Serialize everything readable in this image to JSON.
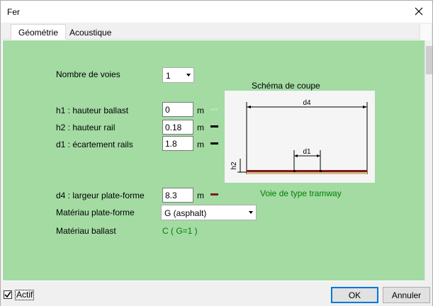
{
  "window": {
    "title": "Fer"
  },
  "tabs": [
    {
      "label": "Géométrie",
      "active": true
    },
    {
      "label": "Acoustique",
      "active": false
    }
  ],
  "form": {
    "nombre_voies": {
      "label": "Nombre de voies",
      "value": "1"
    },
    "h1": {
      "label": "h1 : hauteur ballast",
      "value": "0",
      "unit": "m",
      "swatch_color": "#b5e3b5"
    },
    "h2": {
      "label": "h2 : hauteur rail",
      "value": "0.18",
      "unit": "m",
      "swatch_color": "#000000"
    },
    "d1": {
      "label": "d1 : écartement rails",
      "value": "1.8",
      "unit": "m",
      "swatch_color": "#000000"
    },
    "d4": {
      "label": "d4 : largeur plate-forme",
      "value": "8.3",
      "unit": "m",
      "swatch_color": "#7b1c1c"
    },
    "materiau_plateforme": {
      "label": "Matériau plate-forme",
      "value": "G (asphalt)"
    },
    "materiau_ballast": {
      "label": "Matériau ballast",
      "value": "C  ( G=1 )"
    }
  },
  "schema": {
    "title": "Schéma de coupe",
    "labels": {
      "d4": "d4",
      "d1": "d1",
      "h2": "h2"
    },
    "caption": "Voie de type tramway",
    "colors": {
      "platform": "#7b1c1c",
      "ballast": "#d9b98a"
    }
  },
  "footer": {
    "actif_label": "Actif",
    "actif_checked": true,
    "ok_label": "OK",
    "cancel_label": "Annuler"
  },
  "colors": {
    "panel_bg": "#a3dba3",
    "accent_green": "#008000"
  }
}
